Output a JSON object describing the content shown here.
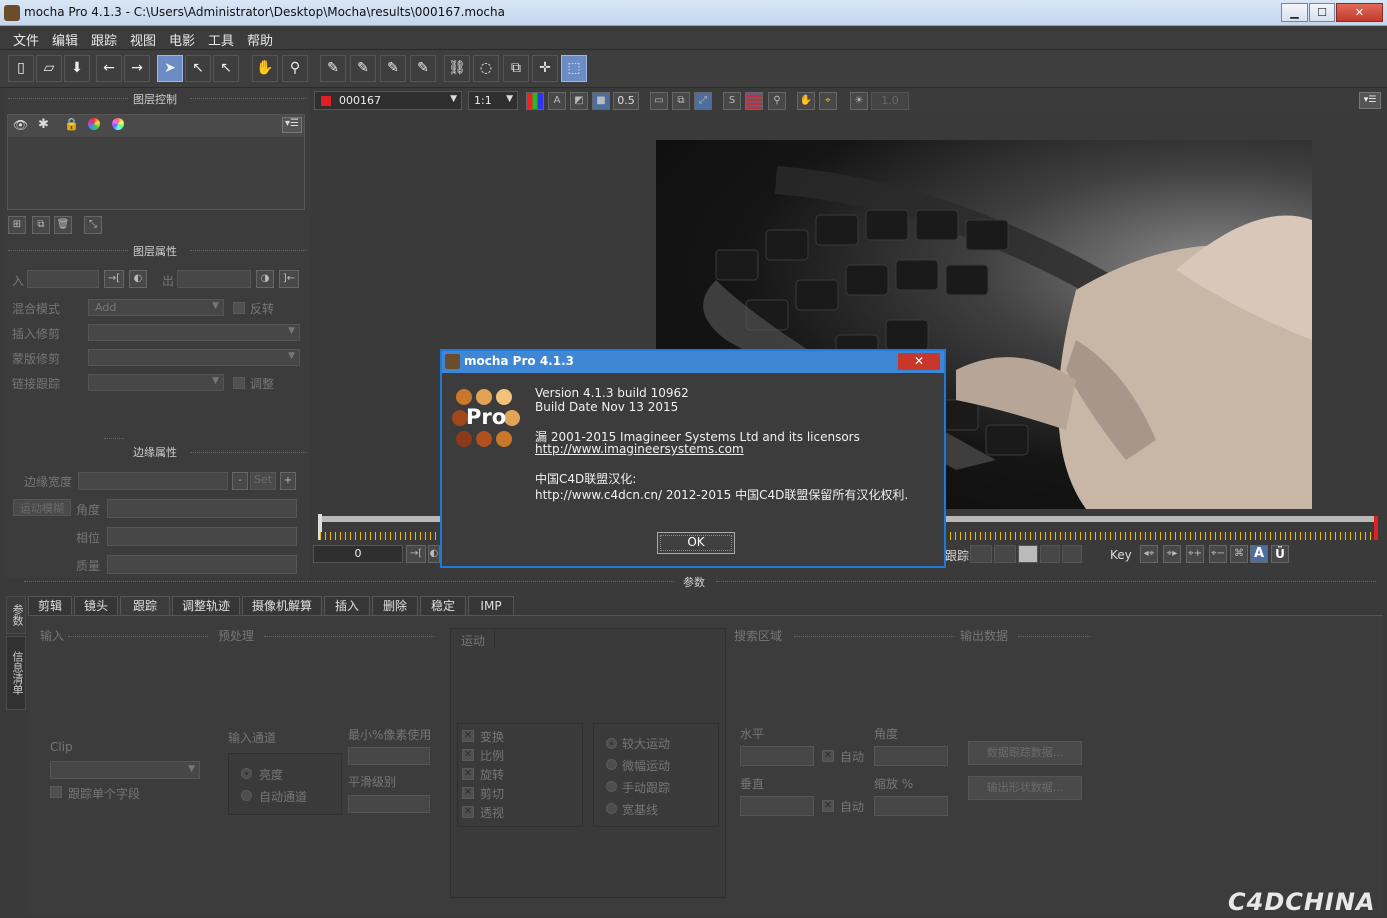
{
  "window": {
    "title": "mocha Pro 4.1.3 - C:\\Users\\Administrator\\Desktop\\Mocha\\results\\000167.mocha",
    "min_label": "▁",
    "max_label": "☐",
    "close_label": "✕"
  },
  "menu": [
    "文件",
    "编辑",
    "跟踪",
    "视图",
    "电影",
    "工具",
    "帮助"
  ],
  "left_panel": {
    "layer_controls_title": "图层控制",
    "layer_properties_title": "图层属性",
    "in_label": "入",
    "out_label": "出",
    "blend_mode_label": "混合模式",
    "blend_mode_value": "Add",
    "invert_label": "反转",
    "insert_clip_label": "插入修剪",
    "matte_clip_label": "蒙版修剪",
    "link_track_label": "链接跟踪",
    "adjust_label": "调整",
    "edge_props_title": "边缘属性",
    "edge_width_label": "边缘宽度",
    "set_label": "Set",
    "motion_blur_label": "运动模糊",
    "angle_label": "角度",
    "phase_label": "相位",
    "quality_label": "质量"
  },
  "viewer_bar": {
    "clip_name": "000167",
    "zoom": "1:1",
    "value_05": "0.5",
    "value_10": "1.0"
  },
  "timeline": {
    "frame": "0",
    "track_label": "跟踪",
    "key_label": "Key"
  },
  "params_label": "参数",
  "side_tabs": [
    "参数",
    "信息清单"
  ],
  "bottom_tabs": [
    "剪辑",
    "镜头",
    "跟踪",
    "调整轨迹",
    "摄像机解算",
    "插入",
    "删除",
    "稳定",
    "IMP"
  ],
  "track_params": {
    "input_title": "输入",
    "preprocess_title": "预处理",
    "motion_title": "运动",
    "search_area_title": "搜索区域",
    "output_title": "输出数据",
    "clip_label": "Clip",
    "track_individual": "跟踪单个字段",
    "input_channel_label": "输入通道",
    "luminance": "亮度",
    "auto_channel": "自动通道",
    "min_pixels_label": "最小%像素使用",
    "smooth_level_label": "平滑级别",
    "transform": "变换",
    "scale": "比例",
    "rotate": "旋转",
    "shear": "剪切",
    "perspective": "透视",
    "large_motion": "较大运动",
    "small_motion": "微幅运动",
    "manual_track": "手动跟踪",
    "existing_planar": "宽基线",
    "horizontal": "水平",
    "vertical": "垂直",
    "angle": "角度",
    "zoom_pct": "缩放 %",
    "auto": "自动",
    "btn_track_data": "数据跟踪数据...",
    "btn_shape_data": "输出形状数据..."
  },
  "about_dialog": {
    "title": "mocha Pro 4.1.3",
    "logo_text": "Pro",
    "version": "Version 4.1.3 build 10962",
    "build_date": "Build Date Nov 13 2015",
    "copyright": "漏 2001-2015 Imagineer Systems Ltd and its licensors",
    "url": "http://www.imagineersystems.com",
    "cn_title": "中国C4D联盟汉化:",
    "cn_line": "http://www.c4dcn.cn/ 2012-2015 中国C4D联盟保留所有汉化权利.",
    "ok_label": "OK"
  },
  "watermark": "C4DCHINA",
  "colors": {
    "accent": "#1e7ad6",
    "timeline_ticks": "#e6c000",
    "close_red": "#c8372b"
  }
}
